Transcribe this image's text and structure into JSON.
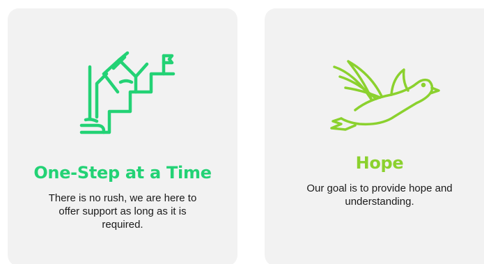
{
  "cards": [
    {
      "title": "One-Step at a Time",
      "description": "There is no rush, we are here to offer support as long as it is required.",
      "icon": "stairs-steps-flag-icon",
      "accent": "#23d275"
    },
    {
      "title": "Hope",
      "description": "Our goal is to provide hope and understanding.",
      "icon": "dove-icon",
      "accent": "#8bd12e"
    }
  ],
  "colors": {
    "card_background": "#f2f2f2",
    "text": "#1a1a1a"
  }
}
